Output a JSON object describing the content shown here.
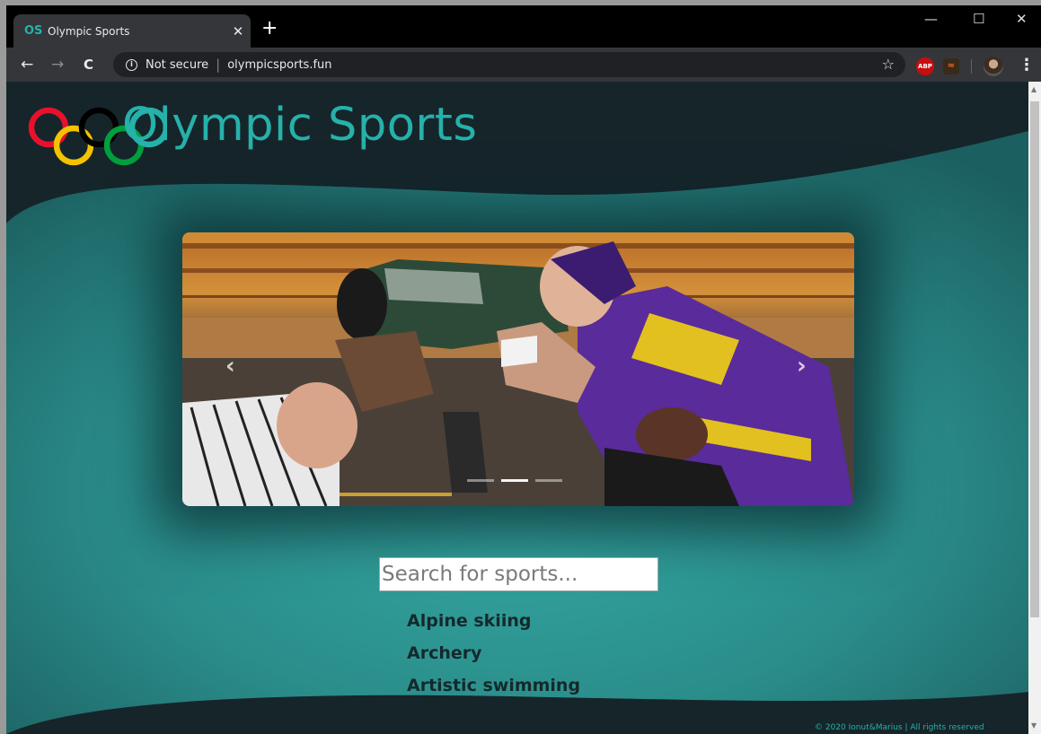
{
  "browser": {
    "tab": {
      "favicon": "OS",
      "title": "Olympic Sports",
      "close_glyph": "✕"
    },
    "new_tab_glyph": "+",
    "window_controls": {
      "minimize": "—",
      "maximize": "☐",
      "close": "✕"
    },
    "nav": {
      "back": "←",
      "forward": "→",
      "reload": "C"
    },
    "omnibox": {
      "info_glyph": "i",
      "security_text": "Not secure",
      "separator": "|",
      "url": "olympicsports.fun",
      "star": "☆"
    },
    "extensions": {
      "abp_label": "ABP",
      "ext2_glyph": "≈"
    },
    "menu_glyph": "⋮"
  },
  "site": {
    "title": "Olympic Sports",
    "logo_ring_colors": [
      "#e8112d",
      "#f4c300",
      "#000000",
      "#009f3d",
      "#26b1aa"
    ],
    "accent_color": "#26b1aa"
  },
  "carousel": {
    "prev_glyph": "‹",
    "next_glyph": "›",
    "slide_count": 3,
    "active_index": 1
  },
  "search": {
    "placeholder": "Search for sports..."
  },
  "sports": [
    "Alpine skiing",
    "Archery",
    "Artistic swimming"
  ],
  "footer": {
    "copyright": "© 2020 Ionut&Marius | All rights reserved"
  },
  "scrollbar": {
    "up": "▲",
    "down": "▼"
  }
}
